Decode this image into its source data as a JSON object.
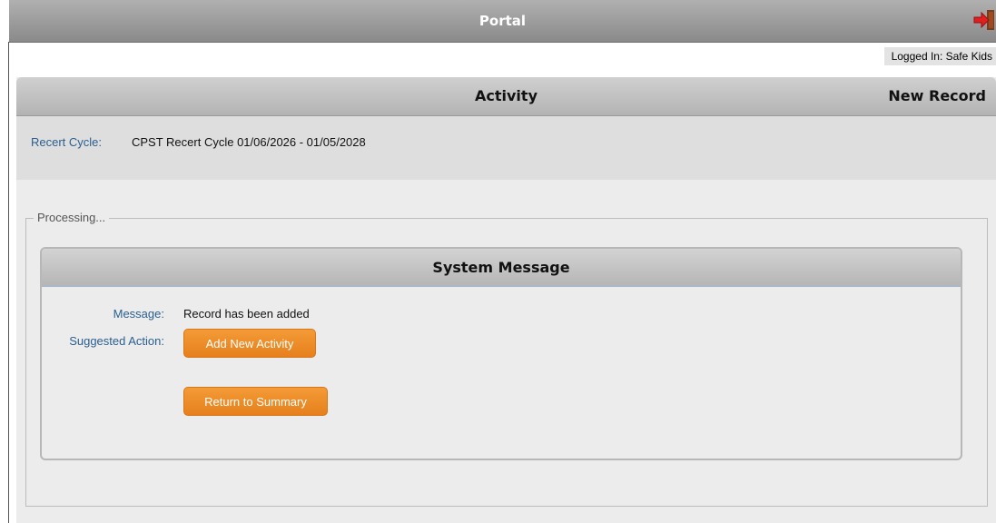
{
  "app": {
    "title": "Portal",
    "logged_in": "Logged In: Safe Kids"
  },
  "panel": {
    "title": "Activity",
    "mode": "New Record",
    "recert_cycle_label": "Recert Cycle:",
    "recert_cycle_value": "CPST Recert Cycle 01/06/2026 - 01/05/2028"
  },
  "processing": {
    "legend": "Processing..."
  },
  "system_message": {
    "title": "System Message",
    "message_label": "Message:",
    "message_value": "Record has been added",
    "suggested_action_label": "Suggested Action:",
    "buttons": {
      "add_new_activity": "Add New Activity",
      "return_to_summary": "Return to Summary"
    }
  },
  "icons": {
    "logout": "logout-icon"
  },
  "colors": {
    "accent_button": "#f0922f",
    "label_blue": "#2a5f8f"
  }
}
